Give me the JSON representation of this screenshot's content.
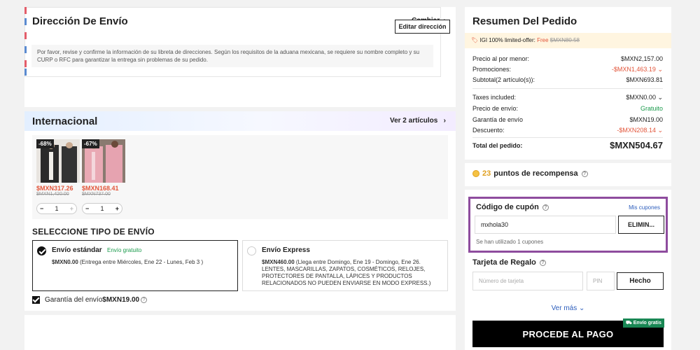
{
  "address": {
    "title": "Dirección De Envío",
    "change_link": "Cambiar",
    "edit_button": "Editar dirección",
    "note": "Por favor, revise y confirme la información de su libreta de direcciones. Según los requisitos de la aduana mexicana, se requiere su nombre completo y su CURP o RFC para garantizar la entrega sin problemas de su pedido.",
    "stripe_colors": [
      "#e35d6a",
      "#5b8bd0",
      "#e35d6a",
      "#5b8bd0",
      "#e35d6a",
      "#5b8bd0"
    ]
  },
  "international": {
    "title": "Internacional",
    "view_link": "Ver 2 artículos",
    "products": [
      {
        "discount": "-68%",
        "price": "$MXN317.26",
        "old_price": "$MXN1,420.00",
        "qty": "1"
      },
      {
        "discount": "-67%",
        "price": "$MXN168.41",
        "old_price": "$MXN737.00",
        "qty": "1"
      }
    ],
    "shipping_title": "SELECCIONE TIPO DE ENVÍO",
    "standard": {
      "name": "Envío estándar",
      "free_tag": "Envío gratuito",
      "price": "$MXN0.00",
      "detail": " (Entrega entre Miércoles, Ene 22 - Lunes, Feb 3 )"
    },
    "express": {
      "name": "Envío Express",
      "price": "$MXN460.00",
      "detail": " (Llega entre Domingo, Ene 19 - Domingo, Ene 26. LENTES, MASCARILLAS, ZAPATOS, COSMÉTICOS, RELOJES, PROTECTORES DE PANTALLA, LÁPICES Y PRODUCTOS RELACIONADOS NO PUEDEN ENVIARSE EN MODO EXPRESS.)"
    },
    "warranty_label": "Garantía del envío ",
    "warranty_value": "$MXN19.00"
  },
  "summary": {
    "title": "Resumen Del Pedido",
    "igi_label": "IGI 100% limited-offer: ",
    "igi_free": "Free",
    "igi_old": "$MXN80.58",
    "rows": [
      {
        "label": "Precio al por menor:",
        "value": "$MXN2,157.00"
      },
      {
        "label": "Promociones:",
        "value": "-$MXN1,463.19"
      },
      {
        "label": "Subtotal(2 artículo(s)):",
        "value": "$MXN693.81"
      },
      {
        "label": "Taxes included:",
        "value": "$MXN0.00"
      },
      {
        "label": "Precio de envío:",
        "value": "Gratuito"
      },
      {
        "label": "Garantía de envío",
        "value": "$MXN19.00"
      },
      {
        "label": "Descuento:",
        "value": "-$MXN208.14"
      }
    ],
    "total_label": "Total del pedido:",
    "total_value": "$MXN504.67",
    "colors": {
      "accent_red": "#e2553a",
      "free_green": "#1a9a4b"
    }
  },
  "points": {
    "count": "23",
    "label": "puntos de recompensa"
  },
  "coupon": {
    "title": "Código de cupón",
    "my_coupons": "Mis cupones",
    "value": "mxhola30",
    "remove_button": "ELIMIN...",
    "used_text": "Se han utilizado 1 cupones",
    "highlight_color": "#8e4c9e"
  },
  "gift": {
    "title": "Tarjeta de Regalo",
    "card_placeholder": "Número de tarjeta",
    "pin_placeholder": "PIN",
    "done_button": "Hecho"
  },
  "see_more": "Ver más",
  "pay_button": "PROCEDE AL PAGO",
  "free_shipping_badge": "Envío gratis"
}
